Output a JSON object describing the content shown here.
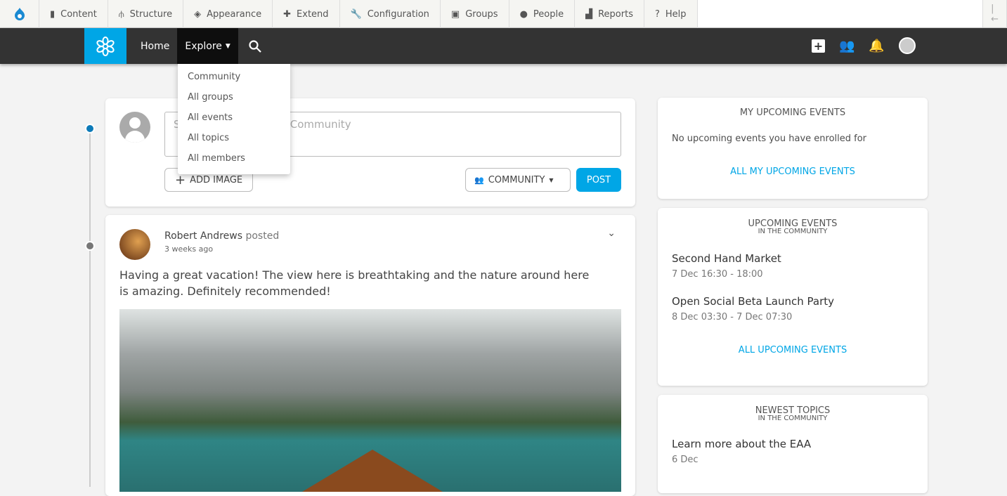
{
  "admin_toolbar": {
    "items": [
      {
        "label": "Content",
        "icon": "file-icon"
      },
      {
        "label": "Structure",
        "icon": "sitemap-icon"
      },
      {
        "label": "Appearance",
        "icon": "paintbrush-icon"
      },
      {
        "label": "Extend",
        "icon": "puzzle-icon"
      },
      {
        "label": "Configuration",
        "icon": "wrench-icon"
      },
      {
        "label": "Groups",
        "icon": "groups-icon"
      },
      {
        "label": "People",
        "icon": "person-icon"
      },
      {
        "label": "Reports",
        "icon": "bar-chart-icon"
      },
      {
        "label": "Help",
        "icon": "help-icon"
      }
    ]
  },
  "nav": {
    "home": "Home",
    "explore": "Explore",
    "explore_menu": [
      "Community",
      "All groups",
      "All events",
      "All topics",
      "All members"
    ]
  },
  "post_form": {
    "placeholder": "Say something to the Community",
    "add_image": "ADD IMAGE",
    "visibility": "COMMUNITY",
    "post": "POST"
  },
  "feed": {
    "author": "Robert Andrews",
    "action": "posted",
    "time": "3 weeks ago",
    "text": "Having a great vacation! The view here is breathtaking and the nature around here is amazing. Definitely recommended!"
  },
  "my_events": {
    "title": "MY UPCOMING EVENTS",
    "empty": "No upcoming events you have enrolled for",
    "link": "ALL MY UPCOMING EVENTS"
  },
  "upcoming": {
    "title": "UPCOMING EVENTS",
    "subtitle": "IN THE COMMUNITY",
    "events": [
      {
        "title": "Second Hand Market",
        "date": "7 Dec 16:30 - 18:00"
      },
      {
        "title": "Open Social Beta Launch Party",
        "date": "8 Dec 03:30 - 7 Dec 07:30"
      }
    ],
    "link": "ALL UPCOMING EVENTS"
  },
  "topics": {
    "title": "NEWEST TOPICS",
    "subtitle": "IN THE COMMUNITY",
    "items": [
      {
        "title": "Learn more about the EAA",
        "date": "6 Dec"
      }
    ]
  },
  "colors": {
    "accent": "#00a6e6",
    "topbar": "#333333"
  }
}
